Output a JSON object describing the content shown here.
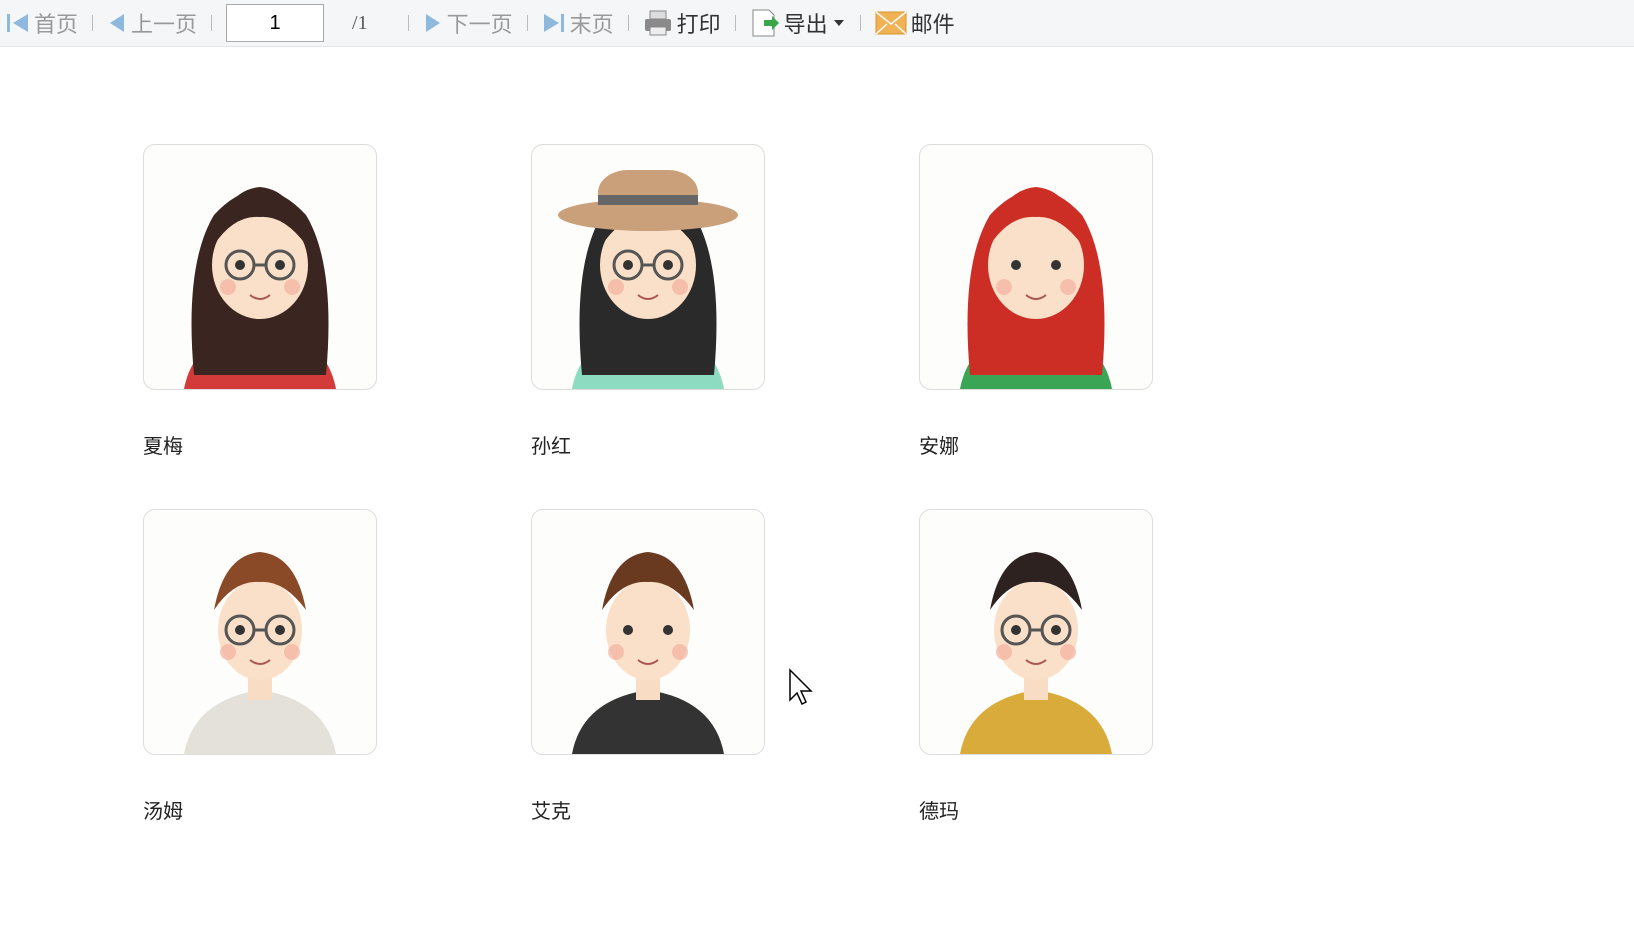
{
  "toolbar": {
    "first": "首页",
    "prev": "上一页",
    "page_value": "1",
    "total": "/1",
    "next": "下一页",
    "last": "末页",
    "print": "打印",
    "export": "导出",
    "mail": "邮件"
  },
  "people": [
    {
      "name": "夏梅",
      "hair": "#3a2520",
      "top": "#d33b3b"
    },
    {
      "name": "孙红",
      "hair": "#2a2a2a",
      "top": "#8ddbc0"
    },
    {
      "name": "安娜",
      "hair": "#cc2e26",
      "top": "#3aa655"
    },
    {
      "name": "汤姆",
      "hair": "#8a4a28",
      "top": "#e4e0da"
    },
    {
      "name": "艾克",
      "hair": "#6a3a20",
      "top": "#333333"
    },
    {
      "name": "德玛",
      "hair": "#2e2220",
      "top": "#d9ab3a"
    }
  ]
}
